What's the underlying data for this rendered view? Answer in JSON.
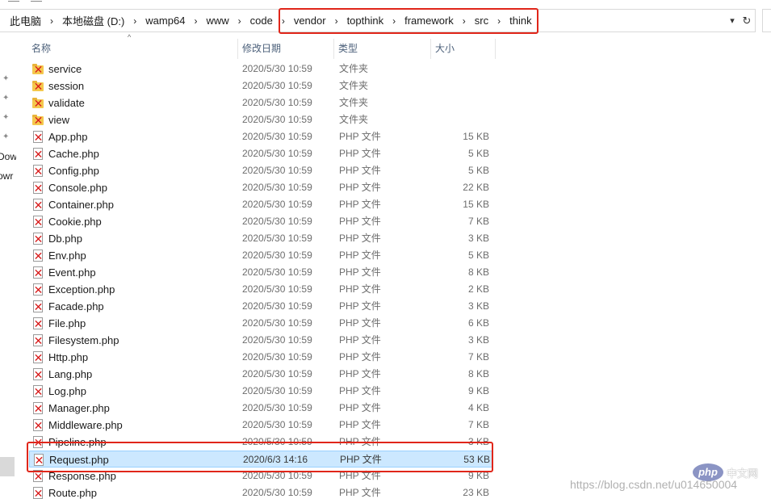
{
  "address_bar": {
    "breadcrumbs": [
      "此电脑",
      "本地磁盘 (D:)",
      "wamp64",
      "www",
      "code",
      "vendor",
      "topthink",
      "framework",
      "src",
      "think"
    ],
    "separator": "›"
  },
  "nav_pane": {
    "items": [
      "Dow",
      "owr"
    ]
  },
  "columns": {
    "name": "名称",
    "date": "修改日期",
    "type": "类型",
    "size": "大小"
  },
  "files": [
    {
      "name": "service",
      "date": "2020/5/30 10:59",
      "type": "文件夹",
      "size": "",
      "kind": "folder"
    },
    {
      "name": "session",
      "date": "2020/5/30 10:59",
      "type": "文件夹",
      "size": "",
      "kind": "folder"
    },
    {
      "name": "validate",
      "date": "2020/5/30 10:59",
      "type": "文件夹",
      "size": "",
      "kind": "folder"
    },
    {
      "name": "view",
      "date": "2020/5/30 10:59",
      "type": "文件夹",
      "size": "",
      "kind": "folder"
    },
    {
      "name": "App.php",
      "date": "2020/5/30 10:59",
      "type": "PHP 文件",
      "size": "15 KB",
      "kind": "file"
    },
    {
      "name": "Cache.php",
      "date": "2020/5/30 10:59",
      "type": "PHP 文件",
      "size": "5 KB",
      "kind": "file"
    },
    {
      "name": "Config.php",
      "date": "2020/5/30 10:59",
      "type": "PHP 文件",
      "size": "5 KB",
      "kind": "file"
    },
    {
      "name": "Console.php",
      "date": "2020/5/30 10:59",
      "type": "PHP 文件",
      "size": "22 KB",
      "kind": "file"
    },
    {
      "name": "Container.php",
      "date": "2020/5/30 10:59",
      "type": "PHP 文件",
      "size": "15 KB",
      "kind": "file"
    },
    {
      "name": "Cookie.php",
      "date": "2020/5/30 10:59",
      "type": "PHP 文件",
      "size": "7 KB",
      "kind": "file"
    },
    {
      "name": "Db.php",
      "date": "2020/5/30 10:59",
      "type": "PHP 文件",
      "size": "3 KB",
      "kind": "file"
    },
    {
      "name": "Env.php",
      "date": "2020/5/30 10:59",
      "type": "PHP 文件",
      "size": "5 KB",
      "kind": "file"
    },
    {
      "name": "Event.php",
      "date": "2020/5/30 10:59",
      "type": "PHP 文件",
      "size": "8 KB",
      "kind": "file"
    },
    {
      "name": "Exception.php",
      "date": "2020/5/30 10:59",
      "type": "PHP 文件",
      "size": "2 KB",
      "kind": "file"
    },
    {
      "name": "Facade.php",
      "date": "2020/5/30 10:59",
      "type": "PHP 文件",
      "size": "3 KB",
      "kind": "file"
    },
    {
      "name": "File.php",
      "date": "2020/5/30 10:59",
      "type": "PHP 文件",
      "size": "6 KB",
      "kind": "file"
    },
    {
      "name": "Filesystem.php",
      "date": "2020/5/30 10:59",
      "type": "PHP 文件",
      "size": "3 KB",
      "kind": "file"
    },
    {
      "name": "Http.php",
      "date": "2020/5/30 10:59",
      "type": "PHP 文件",
      "size": "7 KB",
      "kind": "file"
    },
    {
      "name": "Lang.php",
      "date": "2020/5/30 10:59",
      "type": "PHP 文件",
      "size": "8 KB",
      "kind": "file"
    },
    {
      "name": "Log.php",
      "date": "2020/5/30 10:59",
      "type": "PHP 文件",
      "size": "9 KB",
      "kind": "file"
    },
    {
      "name": "Manager.php",
      "date": "2020/5/30 10:59",
      "type": "PHP 文件",
      "size": "4 KB",
      "kind": "file"
    },
    {
      "name": "Middleware.php",
      "date": "2020/5/30 10:59",
      "type": "PHP 文件",
      "size": "7 KB",
      "kind": "file"
    },
    {
      "name": "Pipeline.php",
      "date": "2020/5/30 10:59",
      "type": "PHP 文件",
      "size": "3 KB",
      "kind": "file"
    },
    {
      "name": "Request.php",
      "date": "2020/6/3 14:16",
      "type": "PHP 文件",
      "size": "53 KB",
      "kind": "file",
      "selected": true
    },
    {
      "name": "Response.php",
      "date": "2020/5/30 10:59",
      "type": "PHP 文件",
      "size": "9 KB",
      "kind": "file"
    },
    {
      "name": "Route.php",
      "date": "2020/5/30 10:59",
      "type": "PHP 文件",
      "size": "23 KB",
      "kind": "file"
    }
  ],
  "watermark": {
    "logo": "php",
    "site_cn": "中文网",
    "url": "https://blog.csdn.net/u014650004"
  },
  "colors": {
    "highlight_red": "#e0261a",
    "selection": "#cce8ff",
    "folder": "#f4c84d",
    "error_x": "#d81b1b"
  }
}
